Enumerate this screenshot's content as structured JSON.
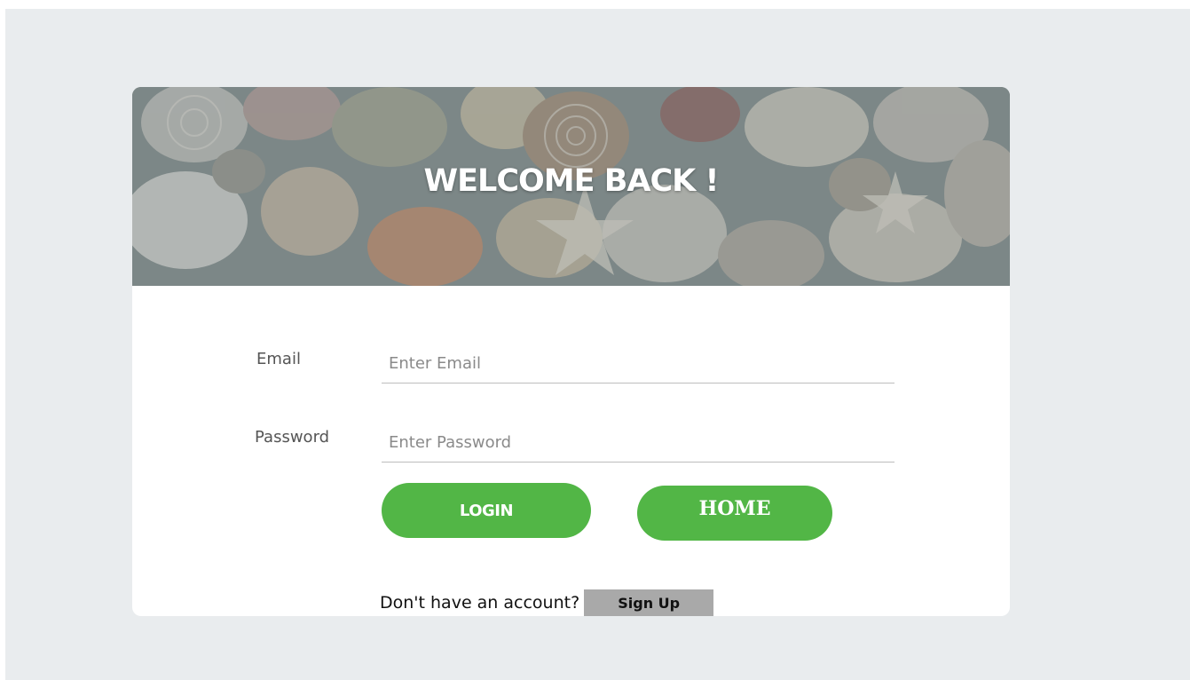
{
  "banner": {
    "title": "WELCOME BACK !"
  },
  "form": {
    "email": {
      "label": "Email",
      "placeholder": "Enter Email",
      "value": ""
    },
    "password": {
      "label": "Password",
      "placeholder": "Enter Password",
      "value": ""
    }
  },
  "buttons": {
    "login_label": "LOGIN",
    "home_label": "HOME"
  },
  "signup": {
    "prompt": "Don't have an account?",
    "button_label": "Sign Up"
  },
  "colors": {
    "page_background": "#e9ecee",
    "card_background": "#ffffff",
    "accent_green": "#52b646",
    "signup_button_gray": "#a9a9a9",
    "banner_text": "#ffffff"
  }
}
